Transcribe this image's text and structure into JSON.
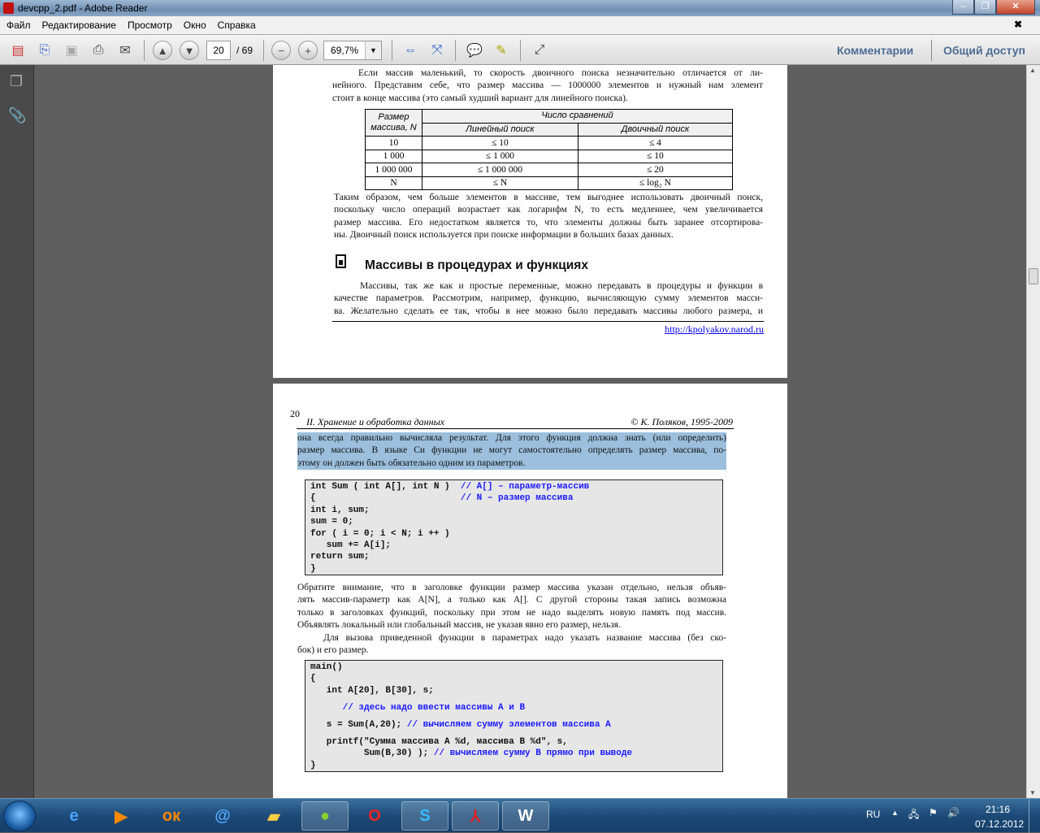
{
  "window": {
    "title": "devcpp_2.pdf - Adobe Reader",
    "min": "–",
    "max": "❐",
    "close": "✕"
  },
  "menu": [
    "Файл",
    "Редактирование",
    "Просмотр",
    "Окно",
    "Справка"
  ],
  "menu_close": "✖",
  "toolbar": {
    "page_current": "20",
    "page_total": "/ 69",
    "zoom": "69,7%",
    "zoom_dropdown": "▼",
    "comments": "Комментарии",
    "share": "Общий доступ"
  },
  "page1": {
    "para1": [
      "Если массив маленький, то скорость двоичного поиска незначительно отличается от ли-",
      "нейного. Представим себе, что размер массива — 1000000 элементов и нужный нам элемент",
      "стоит в конце массива (это самый худший вариант для линейного поиска)."
    ],
    "table": {
      "h_size": "Размер массива, N",
      "h_count": "Число сравнений",
      "h_linear": "Линейный поиск",
      "h_binary": "Двоичный поиск",
      "rows": [
        [
          "10",
          "≤ 10",
          "≤ 4"
        ],
        [
          "1 000",
          "≤ 1 000",
          "≤ 10"
        ],
        [
          "1 000 000",
          "≤ 1 000 000",
          "≤ 20"
        ],
        [
          "N",
          "≤ N",
          "≤ log₂ N"
        ]
      ]
    },
    "para2": [
      "Таким образом, чем больше элементов в массиве, тем выгоднее использовать двоичный поиск,",
      "поскольку число операций возрастает как логарифм N, то есть медленнее, чем увеличивается",
      "размер массива. Его недостатком является то, что элементы должны быть заранее отсортирова-",
      "ны. Двоичный поиск используется при поиске информации в больших базах данных."
    ],
    "section_title": "Массивы в процедурах и функциях",
    "para3": [
      "Массивы, так же как и простые переменные, можно передавать в процедуры и функции в",
      "качестве параметров. Рассмотрим, например, функцию, вычисляющую сумму элементов масси-",
      "ва. Желательно сделать ее так, чтобы в нее можно было передавать массивы любого размера, и"
    ],
    "url": "http://kpolyakov.narod.ru"
  },
  "page2": {
    "page_number": "20",
    "header_left": "II. Хранение и обработка данных",
    "header_right": "© К. Поляков, 1995-2009",
    "selected": [
      "она всегда правильно вычисляла результат. Для этого функция должна знать (или определить)",
      "размер массива. В языке Си функции не могут самостоятельно определять размер массива, по-",
      "этому он должен быть обязательно одним из параметров."
    ],
    "code1": [
      [
        "int Sum ( int A[], int N )  ",
        "// A[] – параметр-массив"
      ],
      [
        "{                           ",
        "// N – размер массива"
      ],
      [
        "int i, sum;",
        ""
      ],
      [
        "sum = 0;",
        ""
      ],
      [
        "for ( i = 0; i < N; i ++ )",
        ""
      ],
      [
        "   sum += A[i];",
        ""
      ],
      [
        "return sum;",
        ""
      ],
      [
        "}",
        ""
      ]
    ],
    "para4": [
      "Обратите внимание, что в заголовке функции размер массива указан отдельно, нельзя объяв-",
      "лять массив-параметр как A[N], а только как A[]. С другой стороны такая запись возможна",
      "только в заголовках функций, поскольку при этом не надо выделять новую память под массив.",
      "Объявлять локальный или глобальный массив, не указав явно его размер, нельзя."
    ],
    "para5": [
      "Для вызова приведенной функции в параметрах надо указать название массива (без ско-",
      "бок) и его размер."
    ],
    "code2": [
      [
        "main()",
        ""
      ],
      [
        "{",
        ""
      ],
      [
        "   int A[20], B[30], s;",
        ""
      ],
      [
        "      ",
        "// здесь надо ввести массивы A и B"
      ],
      [
        "   s = Sum(A,20); ",
        "// вычисляем сумму элементов массива A"
      ],
      [
        "   printf(\"Сумма массива A %d, массива B %d\", s,",
        ""
      ],
      [
        "          Sum(B,30) ); ",
        "// вычисляем сумму B прямо при выводе"
      ],
      [
        "}",
        ""
      ]
    ]
  },
  "tray": {
    "lang": "RU",
    "time": "21:16",
    "date": "07.12.2012"
  },
  "taskbar_apps": [
    "Internet Explorer",
    "Media Player",
    "Odnoklassniki",
    "Browser",
    "Explorer",
    "Game",
    "Opera",
    "Skype",
    "Adobe Reader",
    "Word"
  ]
}
